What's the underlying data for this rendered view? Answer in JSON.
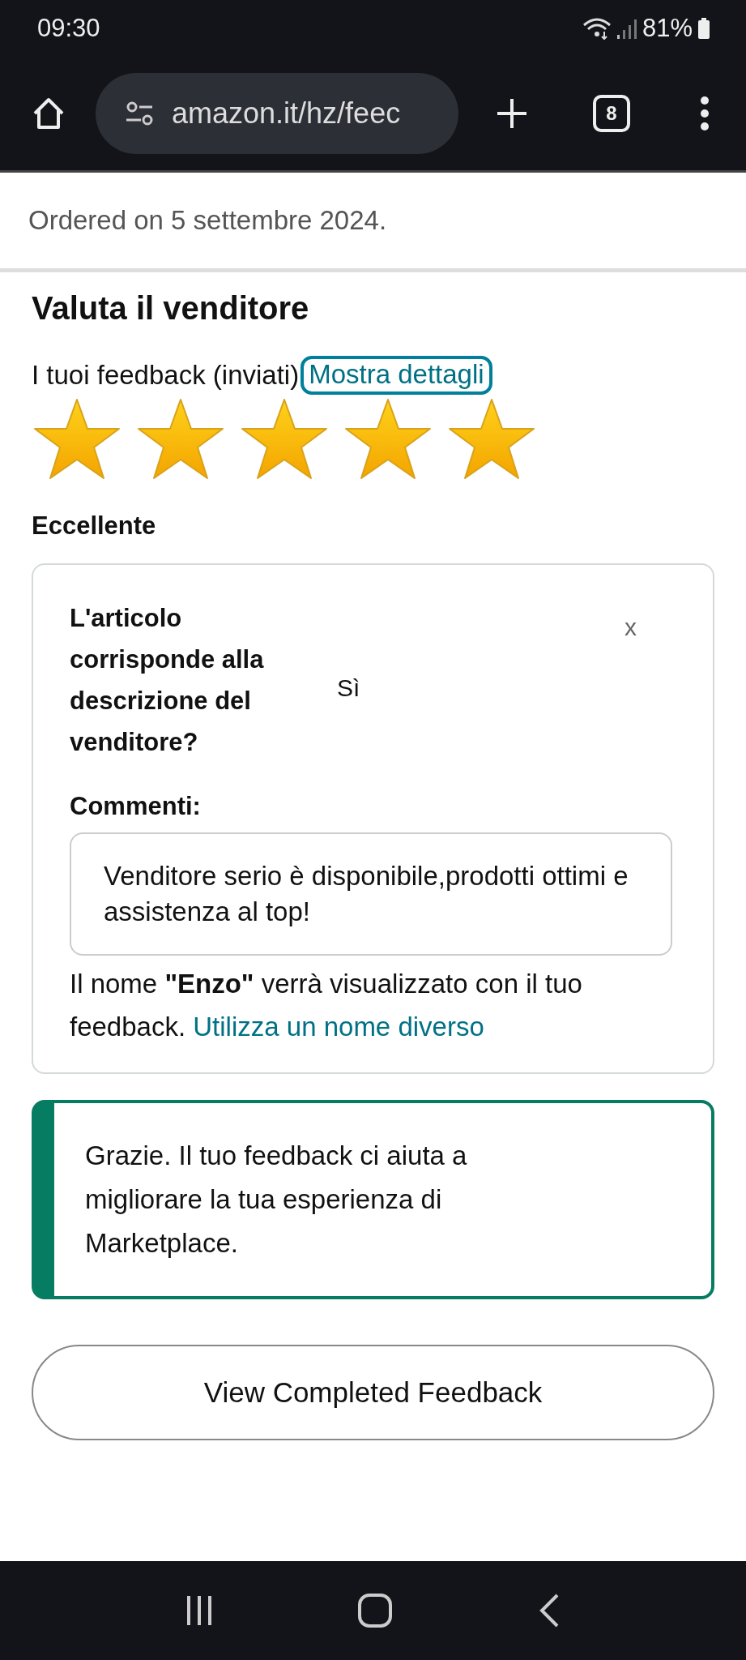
{
  "status_bar": {
    "time": "09:30",
    "battery": "81%"
  },
  "browser_toolbar": {
    "url": "amazon.it/hz/feec",
    "tab_count": "8"
  },
  "order_date": "Ordered on 5 settembre 2024.",
  "section_title": "Valuta il venditore",
  "feedback_label": "I tuoi feedback (inviati)",
  "details_link": "Mostra dettagli",
  "rating": {
    "stars": 5,
    "label": "Eccellente"
  },
  "feedback_card": {
    "question": "L'articolo corrisponde alla descrizione del venditore?",
    "answer": "Sì",
    "close": "x",
    "comments_label": "Commenti:",
    "comment": "Venditore serio è disponibile,prodotti ottimi e assistenza al top!",
    "name_notice": "Il nome **\"Enzo\"** verrà visualizzato con il tuo feedback.",
    "name_link": "Utilizza un nome diverso"
  },
  "success_message": "Grazie. Il tuo feedback ci aiuta a migliorare la tua esperienza di Marketplace.",
  "button": "View Completed Feedback"
}
